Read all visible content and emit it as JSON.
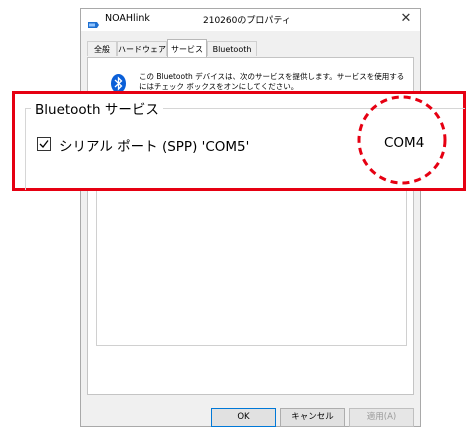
{
  "window": {
    "app_name": "NOAHlink",
    "title": "210260のプロパティ",
    "close_symbol": "✕"
  },
  "tabs": [
    {
      "label": "全般"
    },
    {
      "label": "ハードウェア"
    },
    {
      "label": "サービス"
    },
    {
      "label": "Bluetooth"
    }
  ],
  "active_tab": "サービス",
  "description": "この Bluetooth デバイスは、次のサービスを提供します。サービスを使用するにはチェック ボックスをオンにしてください。",
  "services": {
    "group_title": "Bluetooth サービス",
    "items": [
      {
        "label": "シリアル ポート (SPP) 'COM5'",
        "checked": true,
        "port": "COM4"
      }
    ]
  },
  "buttons": {
    "ok": "OK",
    "cancel": "キャンセル",
    "apply": "適用(A)"
  },
  "colors": {
    "highlight": "#e60012",
    "bluetooth": "#0a5fd8",
    "default_button_border": "#0078d7"
  },
  "icons": {
    "app": "noahlink-icon",
    "service": "bluetooth-icon",
    "checkbox": "checkmark-icon"
  }
}
